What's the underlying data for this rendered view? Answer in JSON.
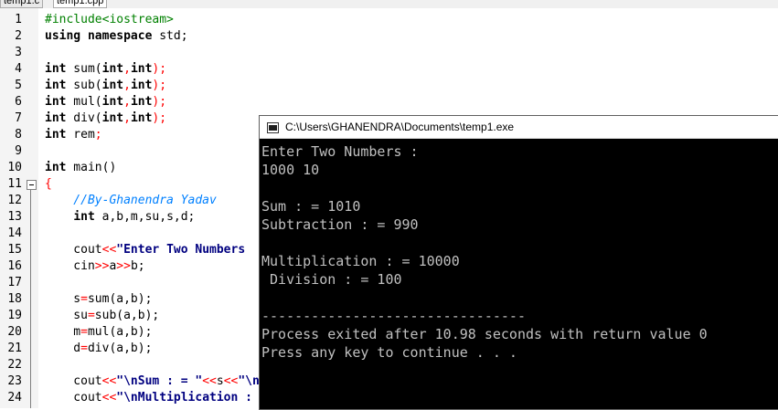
{
  "tabs": [
    {
      "label": "temp1.c",
      "active": false
    },
    {
      "label": "temp1.cpp",
      "active": true
    }
  ],
  "line_numbers": [
    "1",
    "2",
    "3",
    "4",
    "5",
    "6",
    "7",
    "8",
    "9",
    "10",
    "11",
    "12",
    "13",
    "14",
    "15",
    "16",
    "17",
    "18",
    "19",
    "20",
    "21",
    "22",
    "23",
    "24"
  ],
  "code": {
    "l1": {
      "a": "#include<iostream>"
    },
    "l2": {
      "a": "using namespace",
      "b": " std;"
    },
    "l4": {
      "a": "int",
      "b": " sum(",
      "c": "int",
      "d": ",",
      "e": "int",
      "f": ");"
    },
    "l5": {
      "a": "int",
      "b": " sub(",
      "c": "int",
      "d": ",",
      "e": "int",
      "f": ");"
    },
    "l6": {
      "a": "int",
      "b": " mul(",
      "c": "int",
      "d": ",",
      "e": "int",
      "f": ");"
    },
    "l7": {
      "a": "int",
      "b": " div(",
      "c": "int",
      "d": ",",
      "e": "int",
      "f": ");"
    },
    "l8": {
      "a": "int",
      "b": " rem",
      "c": ";"
    },
    "l10": {
      "a": "int",
      "b": " main()"
    },
    "l11": {
      "a": "{"
    },
    "l12": {
      "a": "    //By-Ghanendra Yadav"
    },
    "l13": {
      "a": "    ",
      "b": "int",
      "c": " a,b,m,su,s,d;"
    },
    "l15": {
      "a": "    cout",
      "b": "<<",
      "c": "\"Enter Two Numbers"
    },
    "l16": {
      "a": "    cin",
      "b": ">>",
      "c": "a",
      "d": ">>",
      "e": "b;"
    },
    "l18": {
      "a": "    s",
      "b": "=",
      "c": "sum(a,b);"
    },
    "l19": {
      "a": "    su",
      "b": "=",
      "c": "sub(a,b);"
    },
    "l20": {
      "a": "    m",
      "b": "=",
      "c": "mul(a,b);"
    },
    "l21": {
      "a": "    d",
      "b": "=",
      "c": "div(a,b);"
    },
    "l23": {
      "a": "    cout",
      "b": "<<",
      "c": "\"\\nSum : = \"",
      "d": "<<",
      "e": "s",
      "f": "<<",
      "g": "\"\\n"
    },
    "l24": {
      "a": "    cout",
      "b": "<<",
      "c": "\"\\nMultiplication :"
    }
  },
  "console": {
    "title": "C:\\Users\\GHANENDRA\\Documents\\temp1.exe",
    "lines": [
      "Enter Two Numbers :",
      "1000 10",
      "",
      "Sum : = 1010",
      "Subtraction : = 990",
      "",
      "Multiplication : = 10000",
      " Division : = 100",
      "",
      "--------------------------------",
      "Process exited after 10.98 seconds with return value 0",
      "Press any key to continue . . ."
    ]
  },
  "colors": {
    "keyword": "#000000",
    "preprocessor": "#008000",
    "operator": "#ff0000",
    "string": "#000080",
    "comment": "#0080ff",
    "console_bg": "#000000",
    "console_text": "#c0c0c0"
  }
}
